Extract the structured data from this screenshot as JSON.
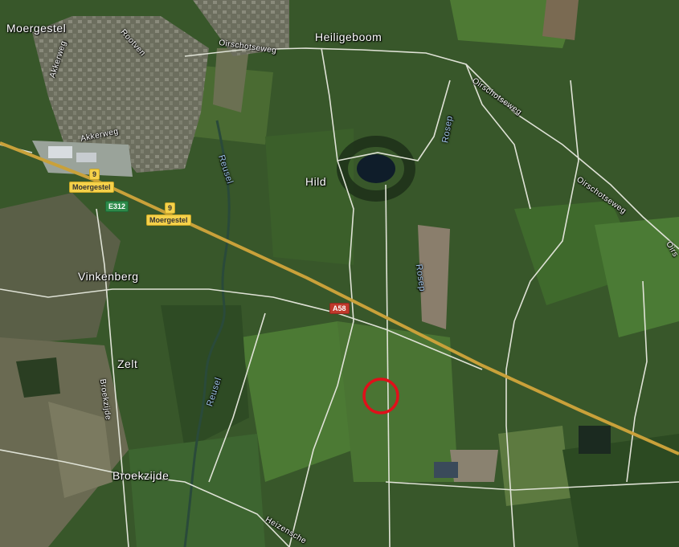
{
  "places": {
    "moergestel": "Moergestel",
    "heiligeboom": "Heiligeboom",
    "hild": "Hild",
    "vinkenberg": "Vinkenberg",
    "zelt": "Zelt",
    "broekzijde": "Broekzijde"
  },
  "roads": {
    "akkerweg_1": "Akkerweg",
    "akkerweg_2": "Akkerweg",
    "rootven": "Rootven",
    "oirschotseweg_1": "Oirschotseweg",
    "oirschotseweg_2": "Oirschotseweg",
    "oirschotseweg_3": "Oirschotseweg",
    "oirschotseweg_4": "Oirs",
    "broekzijde_road": "Broekzijde",
    "heizenschebaan": "Heizensche"
  },
  "water": {
    "reusel_1": "Reusel",
    "reusel_2": "Reusel",
    "rosep_1": "Rosep",
    "rosep_2": "Rosep"
  },
  "shields": {
    "exit_number_1": "9",
    "exit_name_1": "Moergestel",
    "exit_number_2": "9",
    "exit_name_2": "Moergestel",
    "e_route": "E312",
    "a_route": "A58"
  },
  "marker": {
    "color": "#e0101a",
    "icon": "circle-marker-icon"
  },
  "colors": {
    "field_dark": "#2f4a22",
    "field_light": "#4f7a36",
    "road": "#d9dccf",
    "motorway": "#c9a13a"
  }
}
